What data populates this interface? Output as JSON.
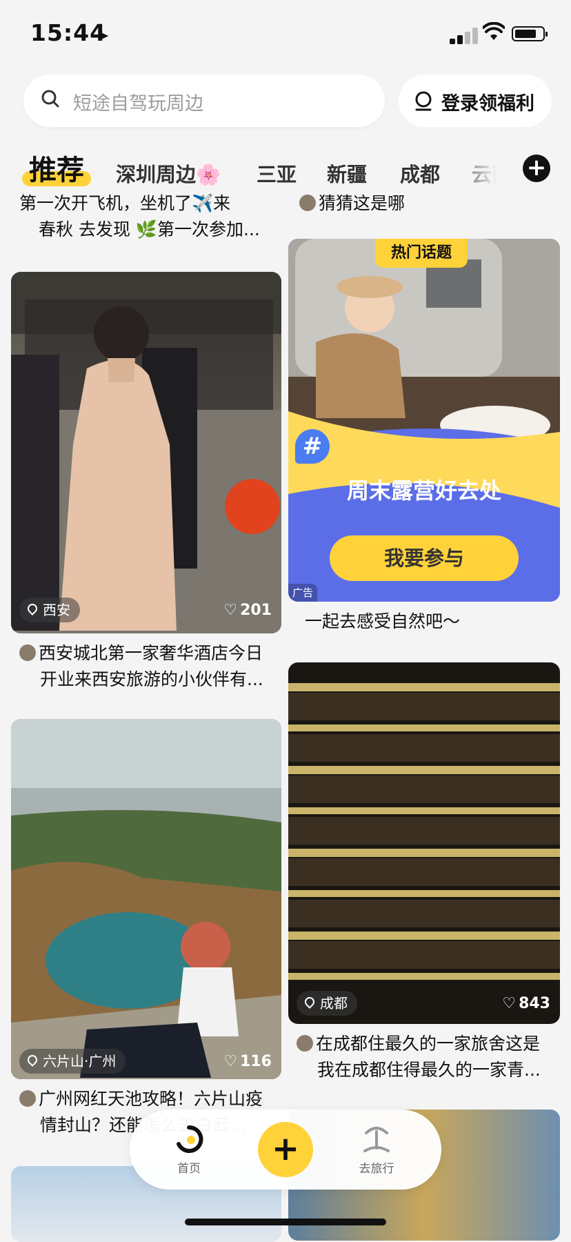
{
  "status": {
    "time": "15:44"
  },
  "search": {
    "placeholder": "短途自驾玩周边",
    "login_label": "登录领福利"
  },
  "tabs": {
    "active": "推荐",
    "items": [
      "深圳周边🌸",
      "三亚",
      "新疆",
      "成都",
      "云南"
    ]
  },
  "feed": {
    "top_left_caption": "第一次开飞机，坐机了✈️来春秋 去发现 🌿第一次参加...",
    "top_left_caption_line1": "第一次开飞机，坐机了✈️来",
    "top_left_caption_line2": "春秋 去发现 🌿第一次参加...",
    "top_right_caption": "猜猜这是哪",
    "card1": {
      "location": "西安",
      "likes": "201",
      "caption_line1": "西安城北第一家奢华酒店今日",
      "caption_line2": "开业来西安旅游的小伙伴有..."
    },
    "ad": {
      "badge": "热门话题",
      "hashtag": "#",
      "title": "周末露营好去处",
      "cta": "我要参与",
      "ad_label": "广告",
      "caption": "一起去感受自然吧～"
    },
    "card2": {
      "location": "六片山·广州",
      "likes": "116",
      "caption_line1": "广州网红天池攻略！六片山疫",
      "caption_line2": "情封山？还能怎么去白云..."
    },
    "card3": {
      "location": "成都",
      "likes": "843",
      "caption_line1": "在成都住最久的一家旅舍这是",
      "caption_line2": "我在成都住得最久的一家青..."
    }
  },
  "nav": {
    "home": "首页",
    "travel": "去旅行"
  },
  "colors": {
    "accent": "#ffd23a",
    "background": "#f4f4f4",
    "ad_blue": "#5b6ee8"
  }
}
